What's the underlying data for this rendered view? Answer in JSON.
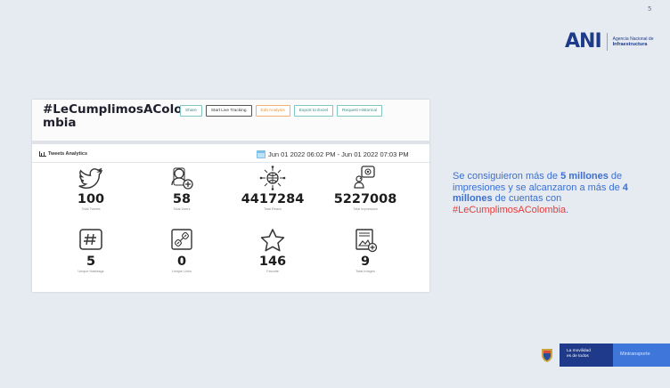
{
  "slide": {
    "page_number": "5",
    "logo": {
      "mark": "ANI",
      "line1": "Agencia Nacional de",
      "line2": "Infraestructura"
    }
  },
  "dashboard": {
    "hashtag_line1": "#LeCumplimosAColo",
    "hashtag_line2": "mbia",
    "buttons": [
      "Share",
      "Start Live Tracking",
      "Edit Analysis",
      "Export to Excel",
      "Request Historical"
    ],
    "analytics_title": "Tweets Analytics",
    "date_range": "Jun 01 2022 06:02 PM - Jun 01 2022 07:03 PM",
    "stats": [
      {
        "icon": "twitter-bird-icon",
        "value": "100",
        "label": "Total Tweets"
      },
      {
        "icon": "users-add-icon",
        "value": "58",
        "label": "Total Users"
      },
      {
        "icon": "reach-globe-icon",
        "value": "4417284",
        "label": "Total Reach"
      },
      {
        "icon": "impressions-icon",
        "value": "5227008",
        "label": "Total Impression"
      },
      {
        "icon": "hashtag-icon",
        "value": "5",
        "label": "Unique Hashtags"
      },
      {
        "icon": "link-icon",
        "value": "0",
        "label": "Unique Links"
      },
      {
        "icon": "star-icon",
        "value": "146",
        "label": "Favorite"
      },
      {
        "icon": "image-icon",
        "value": "9",
        "label": "Total Images"
      }
    ]
  },
  "note": {
    "p1": "Se consiguieron más de ",
    "b1": "5 millones",
    "p2": " de impresiones y se alcanzaron a más de ",
    "b2": "4 millones",
    "p3": " de cuentas con ",
    "tag": "#LeCumplimosAColombia",
    "p4": "."
  },
  "footer": {
    "brand_line1": "La movilidad",
    "brand_line2": "es de todos",
    "ministry": "Mintransporte"
  },
  "colors": {
    "accent_blue": "#3b6fd1",
    "accent_red": "#e53b3b",
    "teal": "#3a8d86"
  }
}
